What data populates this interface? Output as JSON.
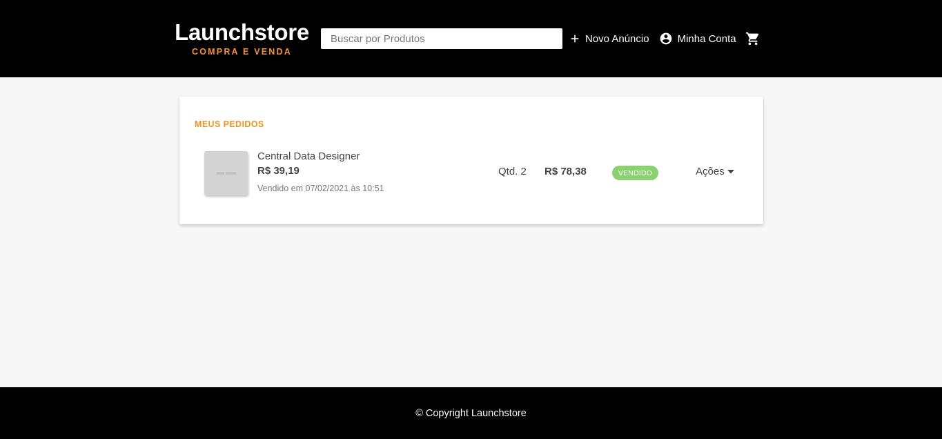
{
  "header": {
    "logo_title": "Launchstore",
    "logo_subtitle": "COMPRA E VENDA",
    "search_placeholder": "Buscar por Produtos",
    "nav": {
      "new_ad": "Novo Anúncio",
      "account": "Minha Conta"
    }
  },
  "main": {
    "section_title": "MEUS PEDIDOS",
    "orders": [
      {
        "product_name": "Central Data Designer",
        "unit_price": "R$ 39,19",
        "date_text": "Vendido em 07/02/2021 às 10:51",
        "quantity": "Qtd. 2",
        "total": "R$ 78,38",
        "status": "VENDIDO",
        "actions_label": "Ações"
      }
    ]
  },
  "footer": {
    "copyright": "© Copyright Launchstore"
  },
  "colors": {
    "brand_accent": "#f7931e",
    "status_sold": "#8ad26d",
    "header_bg": "#000000"
  },
  "icons": {
    "new_ad": "plus-icon",
    "account": "account-circle-icon",
    "cart": "shopping-cart-icon",
    "actions": "caret-down-icon"
  }
}
